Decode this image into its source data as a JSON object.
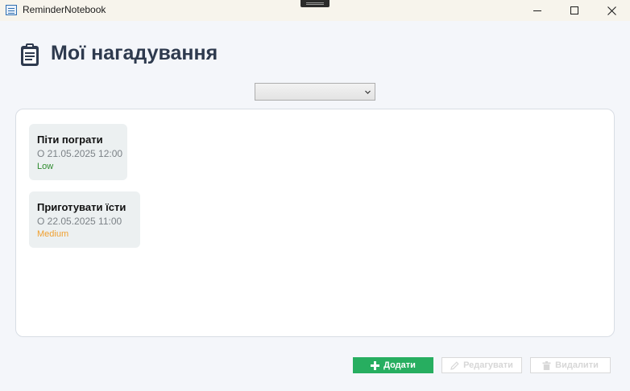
{
  "window": {
    "title": "ReminderNotebook"
  },
  "header": {
    "title": "Мої нагадування",
    "icon": "clipboard-icon"
  },
  "filter": {
    "selected": ""
  },
  "reminders": [
    {
      "title": "Піти пограти",
      "date": "О 21.05.2025 12:00",
      "priority": "Low",
      "priority_color": "#2e8b2e"
    },
    {
      "title": "Приготувати їсти",
      "date": "О 22.05.2025 11:00",
      "priority": "Medium",
      "priority_color": "#f0a030"
    }
  ],
  "actions": {
    "add_label": "Додати",
    "edit_label": "Редагувати",
    "delete_label": "Видалити",
    "add_icon": "plus-icon",
    "edit_icon": "pencil-icon",
    "delete_icon": "trash-icon",
    "add_color": "#27ae60"
  }
}
